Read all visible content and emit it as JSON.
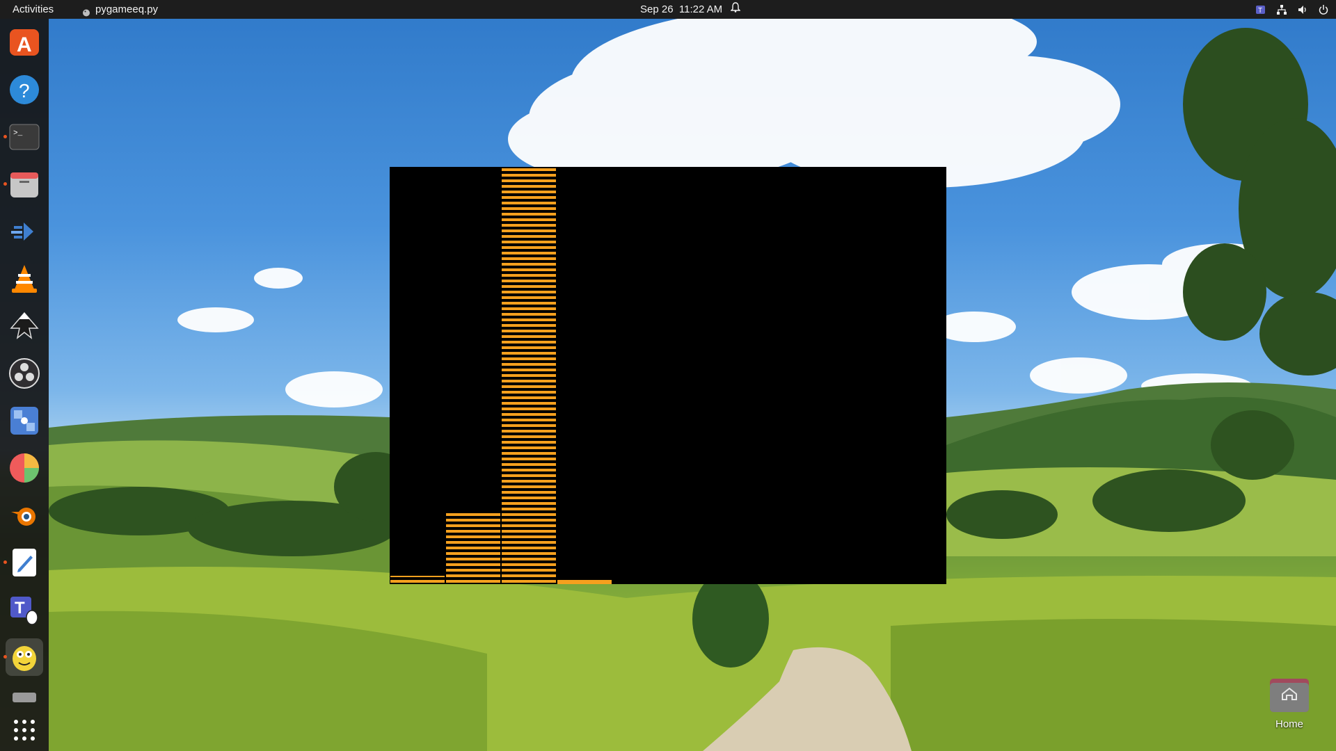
{
  "topbar": {
    "activities": "Activities",
    "app_name": "pygameeq.py",
    "clock": "Sep 26  11:22 AM"
  },
  "dock": {
    "items": [
      {
        "name": "ubuntu-software-icon",
        "running": false
      },
      {
        "name": "help-icon",
        "running": false
      },
      {
        "name": "terminal-icon",
        "running": true
      },
      {
        "name": "files-icon",
        "running": true
      },
      {
        "name": "remote-desktop-icon",
        "running": false
      },
      {
        "name": "vlc-icon",
        "running": false
      },
      {
        "name": "inkscape-icon",
        "running": false
      },
      {
        "name": "obs-icon",
        "running": false
      },
      {
        "name": "app-grid-tool-icon",
        "running": false
      },
      {
        "name": "pie-chart-app-icon",
        "running": false
      },
      {
        "name": "blender-icon",
        "running": false
      },
      {
        "name": "text-editor-icon",
        "running": true
      },
      {
        "name": "teams-linux-icon",
        "running": false
      },
      {
        "name": "pygame-icon",
        "running": true
      },
      {
        "name": "drive-icon",
        "running": false
      },
      {
        "name": "show-applications-icon",
        "running": false
      }
    ]
  },
  "equalizer": {
    "bar_color": "#f5a01e",
    "background": "#000000",
    "bars": [
      0.02,
      0.17,
      1.0,
      0.01,
      0,
      0,
      0,
      0,
      0,
      0
    ]
  },
  "desktop": {
    "home_label": "Home"
  }
}
